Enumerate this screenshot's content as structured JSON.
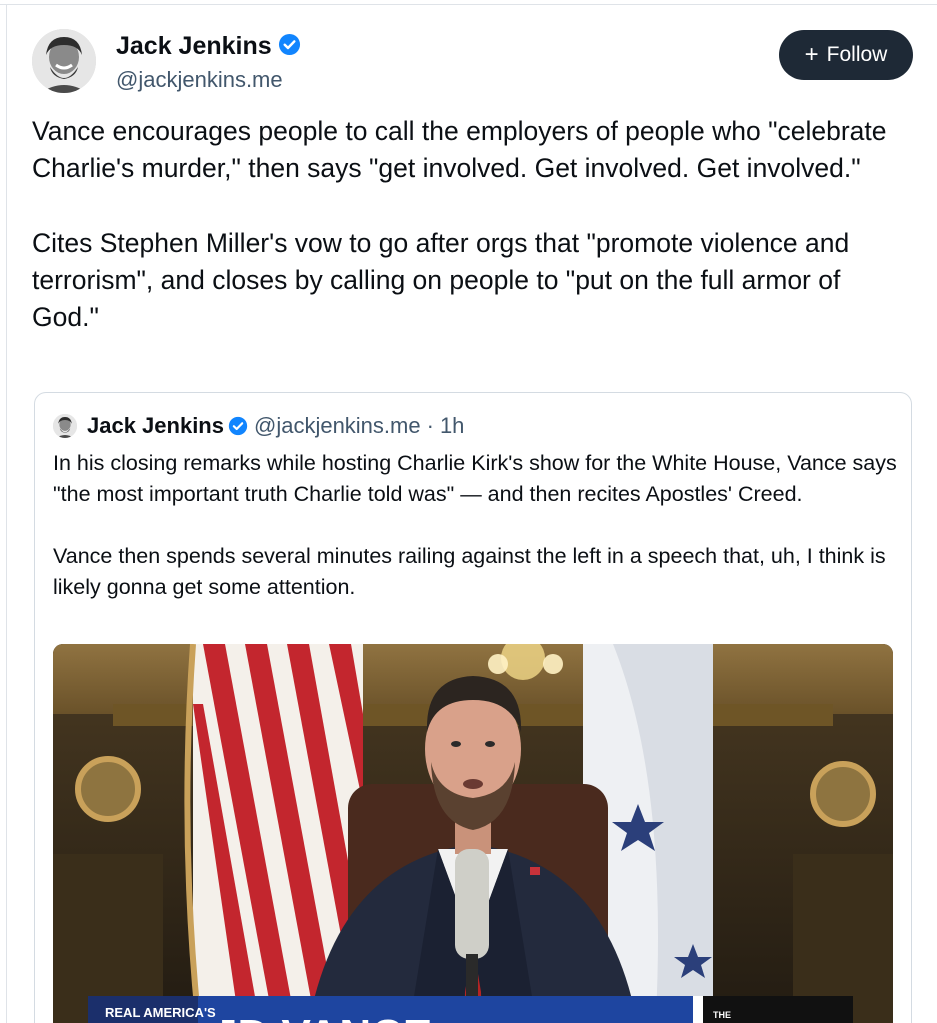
{
  "author": {
    "name": "Jack Jenkins",
    "handle": "@jackjenkins.me",
    "verified": true
  },
  "follow_button": {
    "icon": "+",
    "label": "Follow"
  },
  "post": {
    "text": "Vance encourages people to call the employers of people who \"celebrate Charlie's murder,\" then says \"get involved. Get involved. Get involved.\"\n\nCites Stephen Miller's vow to go after orgs that \"promote violence and terrorism\", and closes by calling on people to \"put on the full armor of God.\""
  },
  "quoted_post": {
    "name": "Jack Jenkins",
    "handle": "@jackjenkins.me",
    "separator": "·",
    "time": "1h",
    "text": "In his closing remarks while hosting Charlie Kirk's show for the White House, Vance says \"the most important truth Charlie told was\" — and then recites Apostles' Creed.\n\nVance then spends several minutes railing against the left in a speech that, uh, I think is likely gonna get some attention.",
    "media": {
      "chyron_brand": "REAL AMERICA'S",
      "chyron_title": "JD VANCE",
      "chyron_right": "THE"
    }
  },
  "colors": {
    "follow_bg": "#1e2936",
    "verified": "#1185fe",
    "secondary_text": "#42576c",
    "border": "#d4dbe2"
  }
}
